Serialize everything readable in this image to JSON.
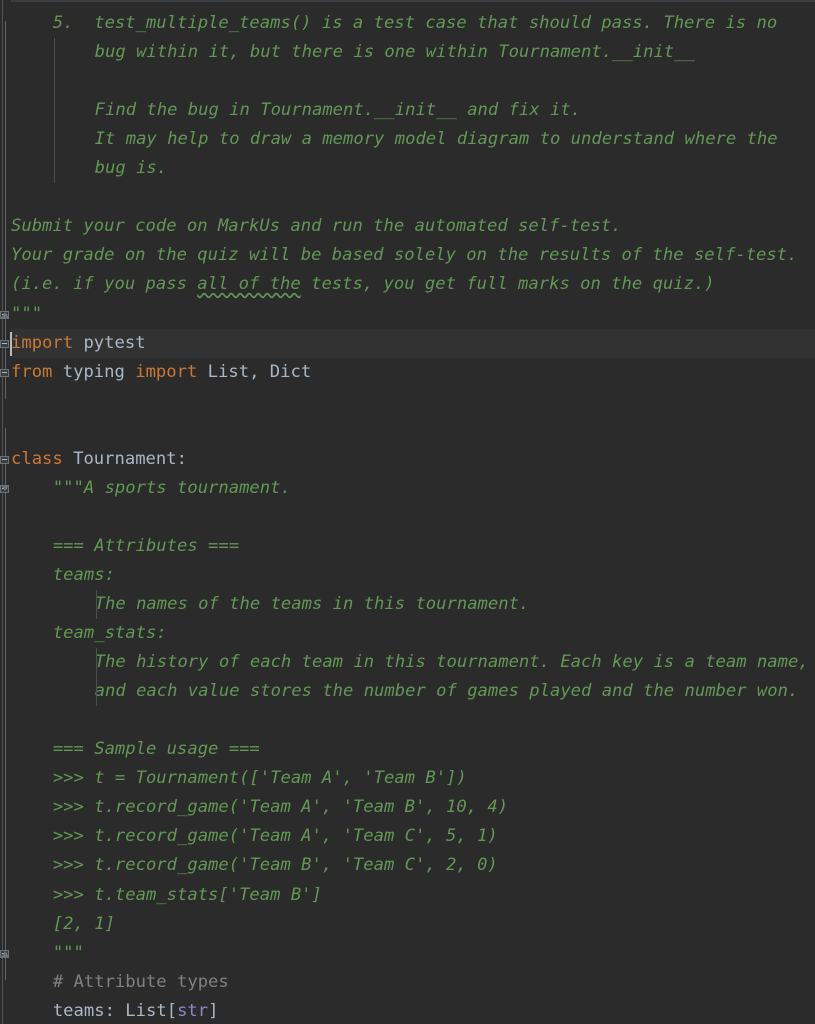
{
  "app": {
    "kind": "code-editor",
    "theme": "darcula",
    "language": "python"
  },
  "colors": {
    "background": "#2b2b2b",
    "current_line": "#323232",
    "keyword": "#cc7832",
    "identifier": "#a9b7c6",
    "docstring": "#629755",
    "comment": "#808080",
    "builtin_type": "#8888c6",
    "gutter_separator": "#4e5254",
    "indent_guide": "#4b5052",
    "caret": "#bbbbbb",
    "typo_underline": "#629755"
  },
  "editor": {
    "caret_line_index": 11,
    "caret_column": 0,
    "lines": [
      {
        "i": 0,
        "indent": 4,
        "text": "5.  test_multiple_teams() is a test case that should pass. There is no",
        "style": "doc"
      },
      {
        "i": 1,
        "indent": 8,
        "text": "bug within it, but there is one within Tournament.__init__",
        "style": "doc"
      },
      {
        "i": 2,
        "indent": 0,
        "text": "",
        "style": "doc"
      },
      {
        "i": 3,
        "indent": 8,
        "text": "Find the bug in Tournament.__init__ and fix it.",
        "style": "doc"
      },
      {
        "i": 4,
        "indent": 8,
        "text": "It may help to draw a memory model diagram to understand where the",
        "style": "doc"
      },
      {
        "i": 5,
        "indent": 8,
        "text": "bug is.",
        "style": "doc"
      },
      {
        "i": 6,
        "indent": 0,
        "text": "",
        "style": "doc"
      },
      {
        "i": 7,
        "indent": 0,
        "text": "Submit your code on MarkUs and run the automated self-test.",
        "style": "doc"
      },
      {
        "i": 8,
        "indent": 0,
        "text": "Your grade on the quiz will be based solely on the results of the self-test.",
        "style": "doc"
      },
      {
        "i": 9,
        "indent": 0,
        "text": "(i.e. if you pass all of the tests, you get full marks on the quiz.)",
        "style": "doc",
        "typo": "all of the"
      },
      {
        "i": 10,
        "indent": 0,
        "text": "\"\"\"",
        "style": "doc"
      },
      {
        "i": 11,
        "indent": 0,
        "text": "import pytest",
        "style": "code"
      },
      {
        "i": 12,
        "indent": 0,
        "text": "from typing import List, Dict",
        "style": "code"
      },
      {
        "i": 13,
        "indent": 0,
        "text": "",
        "style": "code"
      },
      {
        "i": 14,
        "indent": 0,
        "text": "",
        "style": "code"
      },
      {
        "i": 15,
        "indent": 0,
        "text": "class Tournament:",
        "style": "code"
      },
      {
        "i": 16,
        "indent": 4,
        "text": "\"\"\"A sports tournament.",
        "style": "doc"
      },
      {
        "i": 17,
        "indent": 0,
        "text": "",
        "style": "doc"
      },
      {
        "i": 18,
        "indent": 4,
        "text": "=== Attributes ===",
        "style": "doc"
      },
      {
        "i": 19,
        "indent": 4,
        "text": "teams:",
        "style": "doc"
      },
      {
        "i": 20,
        "indent": 8,
        "text": "The names of the teams in this tournament.",
        "style": "doc"
      },
      {
        "i": 21,
        "indent": 4,
        "text": "team_stats:",
        "style": "doc"
      },
      {
        "i": 22,
        "indent": 8,
        "text": "The history of each team in this tournament. Each key is a team name,",
        "style": "doc"
      },
      {
        "i": 23,
        "indent": 8,
        "text": "and each value stores the number of games played and the number won.",
        "style": "doc"
      },
      {
        "i": 24,
        "indent": 0,
        "text": "",
        "style": "doc"
      },
      {
        "i": 25,
        "indent": 4,
        "text": "=== Sample usage ===",
        "style": "doc"
      },
      {
        "i": 26,
        "indent": 4,
        "text": ">>> t = Tournament(['Team A', 'Team B'])",
        "style": "doc"
      },
      {
        "i": 27,
        "indent": 4,
        "text": ">>> t.record_game('Team A', 'Team B', 10, 4)",
        "style": "doc"
      },
      {
        "i": 28,
        "indent": 4,
        "text": ">>> t.record_game('Team A', 'Team C', 5, 1)",
        "style": "doc"
      },
      {
        "i": 29,
        "indent": 4,
        "text": ">>> t.record_game('Team B', 'Team C', 2, 0)",
        "style": "doc"
      },
      {
        "i": 30,
        "indent": 4,
        "text": ">>> t.team_stats['Team B']",
        "style": "doc"
      },
      {
        "i": 31,
        "indent": 4,
        "text": "[2, 1]",
        "style": "doc"
      },
      {
        "i": 32,
        "indent": 4,
        "text": "\"\"\"",
        "style": "doc"
      },
      {
        "i": 33,
        "indent": 4,
        "text": "# Attribute types",
        "style": "comment"
      },
      {
        "i": 34,
        "indent": 4,
        "text": "teams: List[str]",
        "style": "code"
      }
    ]
  },
  "gutter": {
    "fold_markers": [
      {
        "name": "fold-collapse-docstring-end",
        "type": "collapse",
        "line": 10
      },
      {
        "name": "fold-collapse-import-pytest",
        "type": "collapse",
        "line": 11
      },
      {
        "name": "fold-collapse-import-typing",
        "type": "collapse",
        "line": 12
      },
      {
        "name": "fold-collapse-class-tournament",
        "type": "collapse",
        "line": 15
      },
      {
        "name": "fold-collapse-class-docstring",
        "type": "collapse",
        "line": 16
      },
      {
        "name": "fold-collapse-docstring-close",
        "type": "collapse",
        "line": 32
      }
    ]
  }
}
